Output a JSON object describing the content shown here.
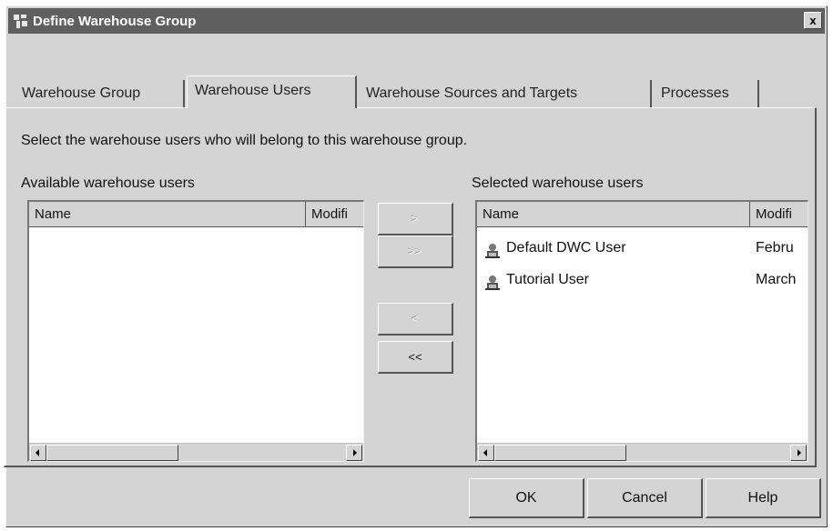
{
  "window": {
    "title": "Define Warehouse Group",
    "close_label": "x"
  },
  "tabs": [
    {
      "label": "Warehouse Group",
      "active": false
    },
    {
      "label": "Warehouse Users",
      "active": true
    },
    {
      "label": "Warehouse Sources and Targets",
      "active": false
    },
    {
      "label": "Processes",
      "active": false
    }
  ],
  "content": {
    "instruction": "Select the warehouse users who will belong to this warehouse group."
  },
  "available": {
    "label": "Available warehouse users",
    "columns": [
      "Name",
      "Modifi"
    ],
    "rows": []
  },
  "selected": {
    "label": "Selected warehouse users",
    "columns": [
      "Name",
      "Modifi"
    ],
    "rows": [
      {
        "name": "Default DWC User",
        "modified": "Febru",
        "icon": "user-icon"
      },
      {
        "name": "Tutorial User",
        "modified": "March",
        "icon": "user-icon"
      }
    ]
  },
  "move_buttons": {
    "add": ">",
    "add_all": ">>",
    "remove": "<",
    "remove_all": "<<"
  },
  "buttons": {
    "ok": "OK",
    "cancel": "Cancel",
    "help": "Help"
  }
}
